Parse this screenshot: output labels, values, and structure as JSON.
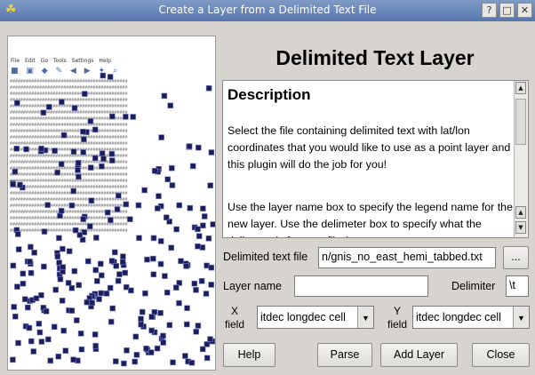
{
  "window": {
    "title": "Create a Layer from a Delimited Text File",
    "buttons": {
      "help": "?",
      "maximize": "□",
      "close": "✕"
    }
  },
  "preview": {
    "menu": [
      "File",
      "Edit",
      "Go",
      "Tools",
      "Settings",
      "Help"
    ]
  },
  "heading": "Delimited Text Layer",
  "description": {
    "title": "Description",
    "paragraph1": "Select the file containing delimited text with lat/lon coordinates that you would like to use as a point layer and this plugin will do the job for you!",
    "paragraph2": "Use the layer name box to specify the legend name for the new layer. Use the delimeter box to specify what the delimeter is for your file (e.g. space, commar"
  },
  "form": {
    "file_label": "Delimited text file",
    "file_value": "n/gnis_no_east_hemi_tabbed.txt",
    "browse_label": "...",
    "layer_name_label": "Layer name",
    "layer_name_value": "",
    "delimiter_label": "Delimiter",
    "delimiter_value": "\\t",
    "x_label_top": "X",
    "x_label_bottom": "field",
    "x_field_value": "itdec longdec cell",
    "y_label_top": "Y",
    "y_label_bottom": "field",
    "y_field_value": "itdec longdec cell"
  },
  "buttons": {
    "help": "Help",
    "parse": "Parse",
    "add_layer": "Add Layer",
    "close": "Close"
  }
}
